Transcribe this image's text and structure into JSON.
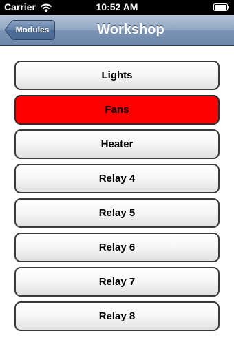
{
  "status_bar": {
    "carrier": "Carrier",
    "time": "10:52 AM",
    "icons": [
      "wifi-icon",
      "battery-icon"
    ]
  },
  "nav": {
    "back_label": "Modules",
    "title": "Workshop"
  },
  "relays": [
    {
      "label": "Lights",
      "active": false
    },
    {
      "label": "Fans",
      "active": true
    },
    {
      "label": "Heater",
      "active": false
    },
    {
      "label": "Relay 4",
      "active": false
    },
    {
      "label": "Relay 5",
      "active": false
    },
    {
      "label": "Relay 6",
      "active": false
    },
    {
      "label": "Relay 7",
      "active": false
    },
    {
      "label": "Relay 8",
      "active": false
    }
  ],
  "colors": {
    "active": "#ff0000",
    "nav_bar": "#8fa5c1",
    "status_bar": "#000000"
  }
}
